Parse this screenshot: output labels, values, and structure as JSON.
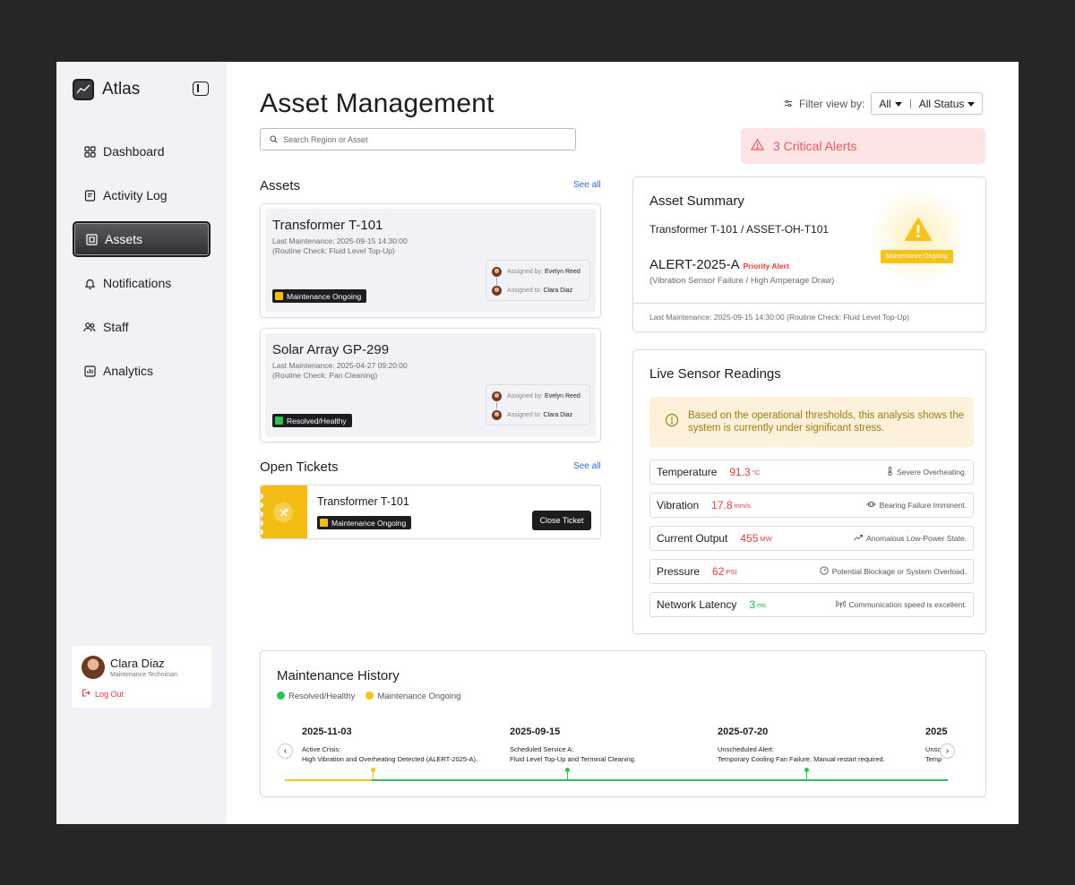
{
  "app": {
    "name": "Atlas"
  },
  "sidebar": {
    "items": [
      {
        "label": "Dashboard",
        "icon": "dashboard-icon"
      },
      {
        "label": "Activity Log",
        "icon": "activity-log-icon"
      },
      {
        "label": "Assets",
        "icon": "assets-icon",
        "active": true
      },
      {
        "label": "Notifications",
        "icon": "bell-icon"
      },
      {
        "label": "Staff",
        "icon": "staff-icon"
      },
      {
        "label": "Analytics",
        "icon": "analytics-icon"
      }
    ],
    "user": {
      "name": "Clara Diaz",
      "role": "Maintenance Technician",
      "logout": "Log Out"
    }
  },
  "header": {
    "title": "Asset Management",
    "search_placeholder": "Search Region or Asset",
    "filter_label": "Filter view by:",
    "filter_region": "All",
    "filter_status": "All Status",
    "critical_alerts": "3 Critical Alerts"
  },
  "assets": {
    "title": "Assets",
    "see_all": "See all",
    "items": [
      {
        "name": "Transformer T-101",
        "last_maintenance": "Last Maintenance: 2025-09-15 14:30:00",
        "note": "(Routine Check: Fluid Level Top-Up)",
        "status": "Maintenance Ongoing",
        "assigned_by_label": "Assigned by:",
        "assigned_by": "Evelyn Reed",
        "assigned_to_label": "Assigned to:",
        "assigned_to": "Clara Diaz"
      },
      {
        "name": "Solar Array GP-299",
        "last_maintenance": "Last Maintenance: 2025-04-27 09:20:00",
        "note": "(Routine Check: Pan Cleaning)",
        "status": "Resolved/Healthy",
        "assigned_by_label": "Assigned by:",
        "assigned_by": "Evelyn Reed",
        "assigned_to_label": "Assigned to:",
        "assigned_to": "Clara Diaz"
      }
    ]
  },
  "tickets": {
    "title": "Open Tickets",
    "see_all": "See all",
    "items": [
      {
        "name": "Transformer T-101",
        "status": "Maintenance Ongoing",
        "action": "Close Ticket"
      }
    ]
  },
  "summary": {
    "title": "Asset Summary",
    "asset": "Transformer T-101 / ASSET-OH-T101",
    "alert_id": "ALERT-2025-A",
    "priority": "Priority Alert",
    "alert_desc": "(Vibration Sensor Failure / High Amperage Draw)",
    "status": "Maintenance Ongoing",
    "last_maintenance": "Last Maintenance: 2025-09-15 14:30:00 (Routine Check: Fluid Level Top-Up)"
  },
  "sensors": {
    "title": "Live Sensor Readings",
    "notice": "Based on the operational thresholds, this analysis shows the system is currently under significant stress.",
    "rows": [
      {
        "label": "Temperature",
        "value": "91.3",
        "unit": "°C",
        "note": "Severe Overheating.",
        "icon": "thermometer-icon",
        "ok": false
      },
      {
        "label": "Vibration",
        "value": "17.8",
        "unit": "mm/s",
        "note": "Bearing Failure Imminent.",
        "icon": "vibration-icon",
        "ok": false
      },
      {
        "label": "Current Output",
        "value": "455",
        "unit": "MW",
        "note": "Anomalous Low-Power State.",
        "icon": "trend-icon",
        "ok": false
      },
      {
        "label": "Pressure",
        "value": "62",
        "unit": "PSI",
        "note": "Potential Blockage or System Overload.",
        "icon": "gauge-icon",
        "ok": false
      },
      {
        "label": "Network Latency",
        "value": "3",
        "unit": "ms",
        "note": "Communication speed is excellent.",
        "icon": "signal-icon",
        "ok": true
      }
    ]
  },
  "history": {
    "title": "Maintenance History",
    "legend": [
      "Resolved/Healthy",
      "Maintenance Ongoing"
    ],
    "events": [
      {
        "date": "2025-11-03",
        "label": "Active Crisis:",
        "desc": "High Vibration and Overheating Detected (ALERT-2025-A)."
      },
      {
        "date": "2025-09-15",
        "label": "Scheduled Service A:",
        "desc": "Fluid Level Top-Up and Terminal Cleaning."
      },
      {
        "date": "2025-07-20",
        "label": "Unscheduled Alert:",
        "desc": "Temporary Cooling Fan Failure. Manual restart required."
      },
      {
        "date": "2025",
        "label": "Unsch",
        "desc": "Temp"
      }
    ]
  },
  "colors": {
    "accent_yellow": "#f3bd16",
    "healthy_green": "#2fc05a",
    "critical_red": "#e23b3b",
    "link_blue": "#2f6bd6"
  }
}
